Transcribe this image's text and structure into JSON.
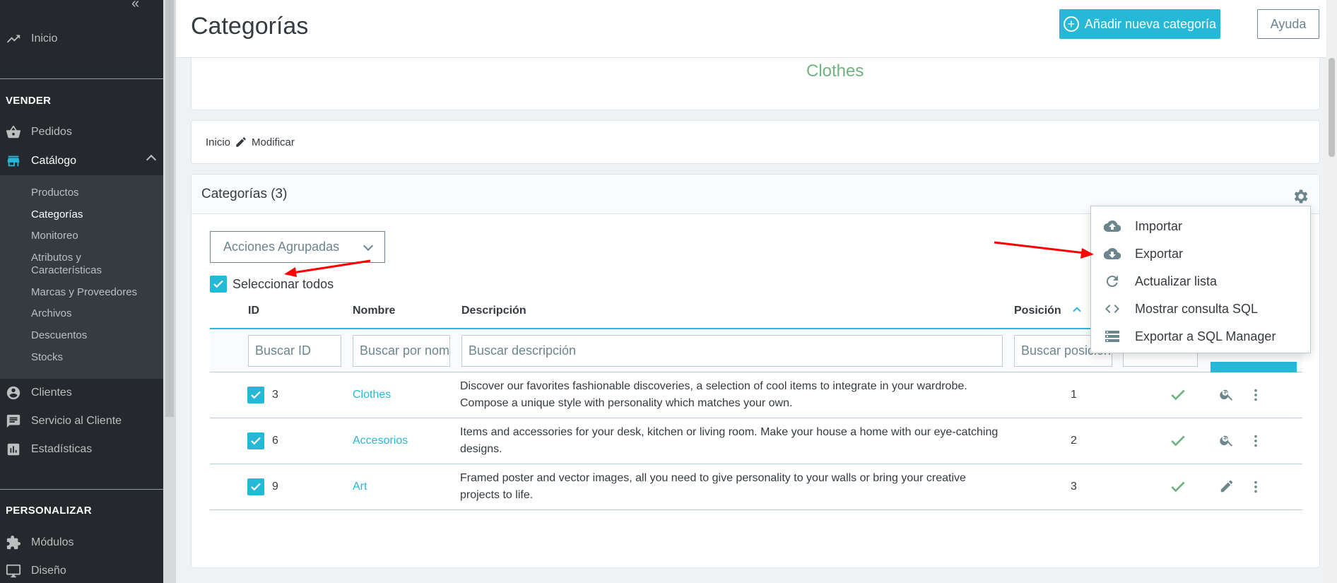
{
  "sidebar": {
    "inicio": "Inicio",
    "section_vender": "VENDER",
    "pedidos": "Pedidos",
    "catalogo": "Catálogo",
    "catalog_items": [
      "Productos",
      "Categorías",
      "Monitoreo",
      "Atributos y Características",
      "Marcas y Proveedores",
      "Archivos",
      "Descuentos",
      "Stocks"
    ],
    "clientes": "Clientes",
    "servicio": "Servicio al Cliente",
    "estadisticas": "Estadísticas",
    "section_personalizar": "PERSONALIZAR",
    "modulos": "Módulos",
    "diseno": "Diseño"
  },
  "header": {
    "title": "Categorías",
    "add_button": "Añadir nueva categoría",
    "help_button": "Ayuda"
  },
  "top_card": {
    "category_name": "Clothes"
  },
  "breadcrumb": {
    "home": "Inicio",
    "edit": "Modificar"
  },
  "list": {
    "title": "Categorías (3)",
    "bulk_actions": "Acciones Agrupadas",
    "select_all": "Seleccionar todos",
    "columns": {
      "id": "ID",
      "name": "Nombre",
      "description": "Descripción",
      "position": "Posición"
    },
    "filters": {
      "id": "Buscar ID",
      "name": "Buscar por nombre",
      "description": "Buscar descripción",
      "position": "Buscar posición"
    },
    "rows": [
      {
        "id": "3",
        "name": "Clothes",
        "description": "Discover our favorites fashionable discoveries, a selection of cool items to integrate in your wardrobe. Compose a unique style with personality which matches your own.",
        "position": "1"
      },
      {
        "id": "6",
        "name": "Accesorios",
        "description": "Items and accessories for your desk, kitchen or living room. Make your house a home with our eye-catching designs.",
        "position": "2"
      },
      {
        "id": "9",
        "name": "Art",
        "description": "Framed poster and vector images, all you need to give personality to your walls or bring your creative projects to life.",
        "position": "3"
      }
    ]
  },
  "dropdown": {
    "items": [
      "Importar",
      "Exportar",
      "Actualizar lista",
      "Mostrar consulta SQL",
      "Exportar a SQL Manager"
    ]
  },
  "colors": {
    "accent": "#25b9d7",
    "success": "#70b580",
    "sidebar": "#25282c",
    "annotation": "#ff0000"
  }
}
